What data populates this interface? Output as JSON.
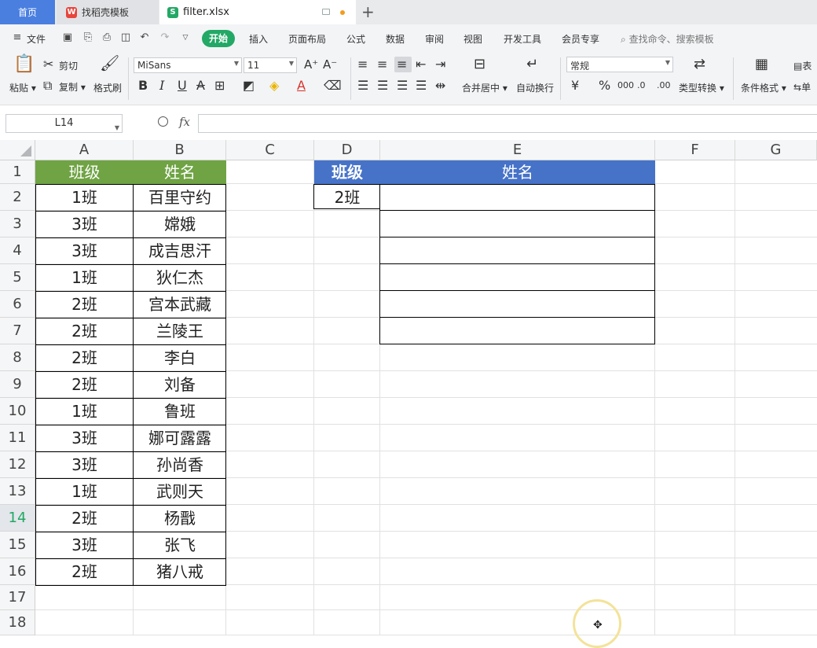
{
  "tabs": {
    "home": "首页",
    "doc": "找稻壳模板",
    "file": "filter.xlsx",
    "doc_badge": "W",
    "file_badge": "S"
  },
  "menu": {
    "file": "文件",
    "items": [
      "开始",
      "插入",
      "页面布局",
      "公式",
      "数据",
      "审阅",
      "视图",
      "开发工具",
      "会员专享"
    ],
    "search": "查找命令、搜索模板"
  },
  "ribbon": {
    "paste": "粘贴",
    "cut": "剪切",
    "copy": "复制",
    "format_painter": "格式刷",
    "font": "MiSans",
    "size": "11",
    "merge": "合并居中",
    "wrap": "自动换行",
    "number_format": "常规",
    "type_convert": "类型转换",
    "cond_format": "条件格式",
    "table_style_partial": "表",
    "cell_partial": "单"
  },
  "formula_bar": {
    "name_box": "L14",
    "fx": "fx",
    "content": ""
  },
  "columns": [
    "A",
    "B",
    "C",
    "D",
    "E",
    "F",
    "G"
  ],
  "rows": [
    "1",
    "2",
    "3",
    "4",
    "5",
    "6",
    "7",
    "8",
    "9",
    "10",
    "11",
    "12",
    "13",
    "14",
    "15",
    "16",
    "17",
    "18"
  ],
  "active_row": "14",
  "table_ab": {
    "header": [
      "班级",
      "姓名"
    ],
    "rows": [
      [
        "1班",
        "百里守约"
      ],
      [
        "3班",
        "嫦娥"
      ],
      [
        "3班",
        "成吉思汗"
      ],
      [
        "1班",
        "狄仁杰"
      ],
      [
        "2班",
        "宫本武藏"
      ],
      [
        "2班",
        "兰陵王"
      ],
      [
        "2班",
        "李白"
      ],
      [
        "2班",
        "刘备"
      ],
      [
        "1班",
        "鲁班"
      ],
      [
        "3班",
        "娜可露露"
      ],
      [
        "3班",
        "孙尚香"
      ],
      [
        "1班",
        "武则天"
      ],
      [
        "2班",
        "杨戬"
      ],
      [
        "3班",
        "张飞"
      ],
      [
        "2班",
        "猪八戒"
      ]
    ]
  },
  "table_de": {
    "header": [
      "班级",
      "姓名"
    ],
    "criteria": "2班"
  },
  "colors": {
    "green_header": "#6fa344",
    "blue_header": "#4673c8",
    "accent": "#23a866"
  }
}
